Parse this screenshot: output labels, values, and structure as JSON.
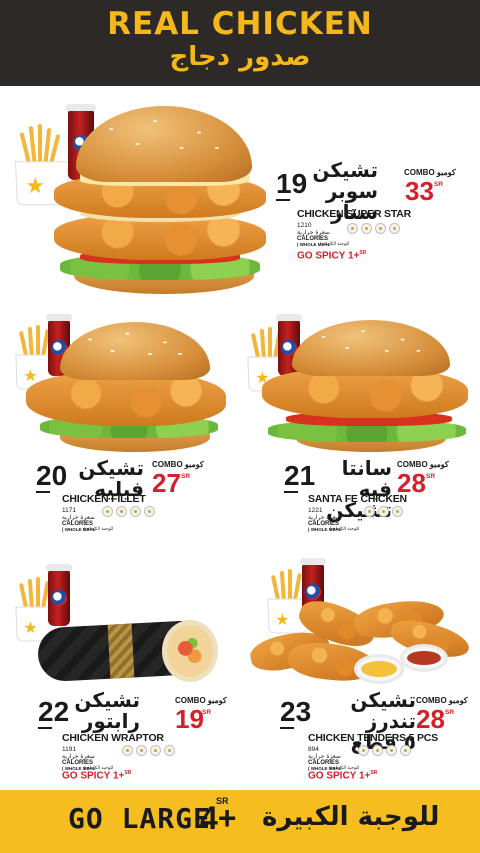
{
  "header": {
    "title_en": "REAL CHICKEN",
    "title_ar": "صدور دجاج"
  },
  "items": [
    {
      "number": "19",
      "name_ar_line1": "تشيكن",
      "name_ar_line2": "سوبر ستار",
      "name_en": "CHICKEN SUPER STAR",
      "combo_label": "COMBO كومبو",
      "price": "33",
      "currency": "SR",
      "calories_value": "1210",
      "calories_ar": "سعرة حرارية",
      "calories_en": "CALORIES",
      "meal_ar": "( للوجبة الكاملة",
      "meal_en": "( WHOLE MEAL",
      "spicy": "GO SPICY 1+",
      "spicy_sr": "SR",
      "allergens": [
        "egg-icon",
        "wheat-icon",
        "wheat-icon",
        "mustard-icon"
      ]
    },
    {
      "number": "20",
      "name_ar_line1": "تشيكن",
      "name_ar_line2": "فيليه",
      "name_en": "CHICKEN FILLET",
      "combo_label": "COMBO كومبو",
      "price": "27",
      "currency": "SR",
      "calories_value": "1171",
      "calories_ar": "سعرة حرارية",
      "calories_en": "CALORIES",
      "meal_ar": "( للوجبة الكاملة",
      "meal_en": "( WHOLE MEAL",
      "allergens": [
        "egg-icon",
        "wheat-icon",
        "wheat-icon",
        "mustard-icon"
      ]
    },
    {
      "number": "21",
      "name_ar_line1": "سانتا فيه",
      "name_ar_line2": "تشيكن",
      "name_en": "SANTA FE CHICKEN",
      "combo_label": "COMBO كومبو",
      "price": "28",
      "currency": "SR",
      "calories_value": "1221",
      "calories_ar": "سعرة حرارية",
      "calories_en": "CALORIES",
      "meal_ar": "( للوجبة الكاملة",
      "meal_en": "( WHOLE MEAL",
      "allergens": [
        "egg-icon",
        "wheat-icon",
        "mustard-icon"
      ]
    },
    {
      "number": "22",
      "name_ar_line1": "تشيكن",
      "name_ar_line2": "رابتور",
      "name_en": "CHICKEN WRAPTOR",
      "combo_label": "COMBO كومبو",
      "price": "19",
      "currency": "SR",
      "calories_value": "1191",
      "calories_ar": "سعرة حرارية",
      "calories_en": "CALORIES",
      "meal_ar": "( للوجبة الكاملة",
      "meal_en": "( WHOLE MEAL",
      "spicy": "GO SPICY 1+",
      "spicy_sr": "SR",
      "allergens": [
        "egg-icon",
        "wheat-icon",
        "wheat-icon",
        "mustard-icon"
      ]
    },
    {
      "number": "23",
      "name_ar_line1": "تشيكن تندرز",
      "name_ar_line2": "٥ قطع",
      "name_en": "CHICKEN TENDERS 5 PCS",
      "combo_label": "COMBO كومبو",
      "price": "28",
      "currency": "SR",
      "calories_value": "894",
      "calories_ar": "سعرة حرارية",
      "calories_en": "CALORIES",
      "meal_ar": "( للوجبة الكاملة",
      "meal_en": "( WHOLE MEAL",
      "spicy": "GO SPICY 1+",
      "spicy_sr": "SR",
      "allergens": [
        "egg-icon",
        "wheat-icon",
        "wheat-icon",
        "mustard-icon"
      ]
    }
  ],
  "footer": {
    "go_large": "GO LARGE",
    "amount": "4+",
    "currency": "SR",
    "label_ar": "للوجبة الكبيرة"
  },
  "colors": {
    "header_bg": "#2d2926",
    "accent_yellow": "#f5bd1f",
    "price_red": "#d4202a"
  }
}
